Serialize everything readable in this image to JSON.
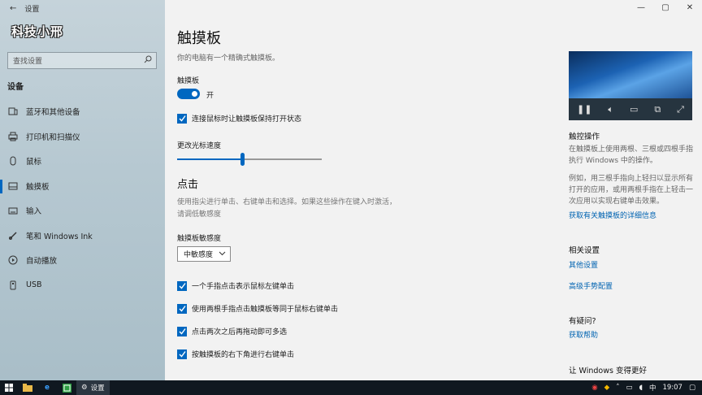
{
  "window": {
    "title": "设置"
  },
  "watermark": "科技小邢",
  "search": {
    "placeholder": "查找设置"
  },
  "sidebar": {
    "section": "设备",
    "items": [
      {
        "label": "蓝牙和其他设备",
        "icon": "bluetooth-devices-icon"
      },
      {
        "label": "打印机和扫描仪",
        "icon": "printer-icon"
      },
      {
        "label": "鼠标",
        "icon": "mouse-icon"
      },
      {
        "label": "触摸板",
        "icon": "touchpad-icon",
        "active": true
      },
      {
        "label": "输入",
        "icon": "keyboard-icon"
      },
      {
        "label": "笔和 Windows Ink",
        "icon": "pen-icon"
      },
      {
        "label": "自动播放",
        "icon": "autoplay-icon"
      },
      {
        "label": "USB",
        "icon": "usb-icon"
      }
    ]
  },
  "main": {
    "title": "触摸板",
    "subtitle": "你的电脑有一个精确式触摸板。",
    "touchpad_label": "触摸板",
    "toggle_state": "开",
    "toggle_on": true,
    "leave_on_label": "连接鼠标时让触摸板保持打开状态",
    "leave_on_checked": true,
    "cursor_speed_label": "更改光标速度",
    "cursor_speed_fraction": 0.45,
    "taps_heading": "点击",
    "taps_description": "使用指尖进行单击、右键单击和选择。如果这些操作在键入时激活，请调低敏感度",
    "sensitivity_label": "触摸板敏感度",
    "sensitivity_value": "中敏感度",
    "tap_options": [
      {
        "label": "一个手指点击表示鼠标左键单击",
        "checked": true
      },
      {
        "label": "使用两根手指点击触摸板等同于鼠标右键单击",
        "checked": true
      },
      {
        "label": "点击两次之后再拖动即可多选",
        "checked": true
      },
      {
        "label": "按触摸板的右下角进行右键单击",
        "checked": true
      }
    ]
  },
  "right": {
    "gestures_heading": "触控操作",
    "gestures_p1": "在触摸板上使用两根、三根或四根手指执行 Windows 中的操作。",
    "gestures_p2": "例如，用三根手指向上轻扫以显示所有打开的应用，或用两根手指在上轻击一次应用以实现右键单击效果。",
    "more_info_link": "获取有关触摸板的详细信息",
    "related_heading": "相关设置",
    "other_settings_link": "其他设置",
    "advanced_gestures_link": "高级手势配置",
    "question_heading": "有疑问?",
    "help_link": "获取帮助",
    "improve_heading": "让 Windows 变得更好"
  },
  "taskbar": {
    "settings_label": "设置",
    "ime": "中",
    "time": "19:07"
  },
  "colors": {
    "accent": "#0067c0",
    "link": "#0063b1"
  }
}
